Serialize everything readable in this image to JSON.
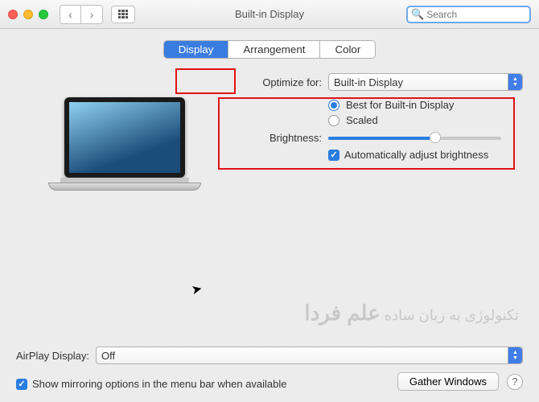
{
  "titlebar": {
    "title": "Built-in Display",
    "search_placeholder": "Search"
  },
  "tabs": {
    "display": "Display",
    "arrangement": "Arrangement",
    "color": "Color"
  },
  "settings": {
    "optimize_label": "Optimize for:",
    "optimize_value": "Built-in Display",
    "radio_best": "Best for Built-in Display",
    "radio_scaled": "Scaled",
    "brightness_label": "Brightness:",
    "auto_brightness": "Automatically adjust brightness"
  },
  "airplay": {
    "label": "AirPlay Display:",
    "value": "Off"
  },
  "bottom": {
    "mirroring": "Show mirroring options in the menu bar when available",
    "gather": "Gather Windows"
  },
  "watermark": {
    "brand": "علم فردا",
    "tagline": "تکنولوژی به زبان ساده"
  }
}
